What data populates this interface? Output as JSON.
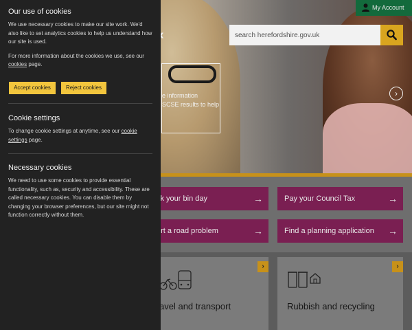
{
  "header": {
    "account_label": "My Account",
    "search_placeholder": "search herefordshire.gov.uk"
  },
  "hero": {
    "text_line1": "e information",
    "text_line2": "SCSE results to help"
  },
  "quick_links": [
    {
      "label": "ck your bin day"
    },
    {
      "label": "Pay your Council Tax"
    },
    {
      "label": "ort a road problem"
    },
    {
      "label": "Find a planning application"
    }
  ],
  "cards": [
    {
      "title": "avel and transport"
    },
    {
      "title": "Rubbish and recycling"
    }
  ],
  "cookies": {
    "title": "Our use of cookies",
    "intro": "We use necessary cookies to make our site work. We'd also like to set analytics cookies to help us understand how our site is used.",
    "more_info_prefix": "For more information about the cookies we use, see our ",
    "more_info_link": "cookies",
    "more_info_suffix": " page.",
    "accept_label": "Accept cookies",
    "reject_label": "Reject cookies",
    "settings_title": "Cookie settings",
    "settings_prefix": "To change cookie settings at anytime, see our ",
    "settings_link": "cookie settings",
    "settings_suffix": " page.",
    "necessary_title": "Necessary cookies",
    "necessary_text": "We need to use some cookies to provide essential functionality, such as, security and accessibility. These are called necessary cookies. You can disable them by changing your browser preferences, but our site might not function correctly without them."
  },
  "colors": {
    "panel_bg": "#222222",
    "button_yellow": "#f2c53d",
    "account_green": "#136a3c",
    "quick_link_purple": "#7a1f52",
    "accent_gold": "#c7911a"
  }
}
